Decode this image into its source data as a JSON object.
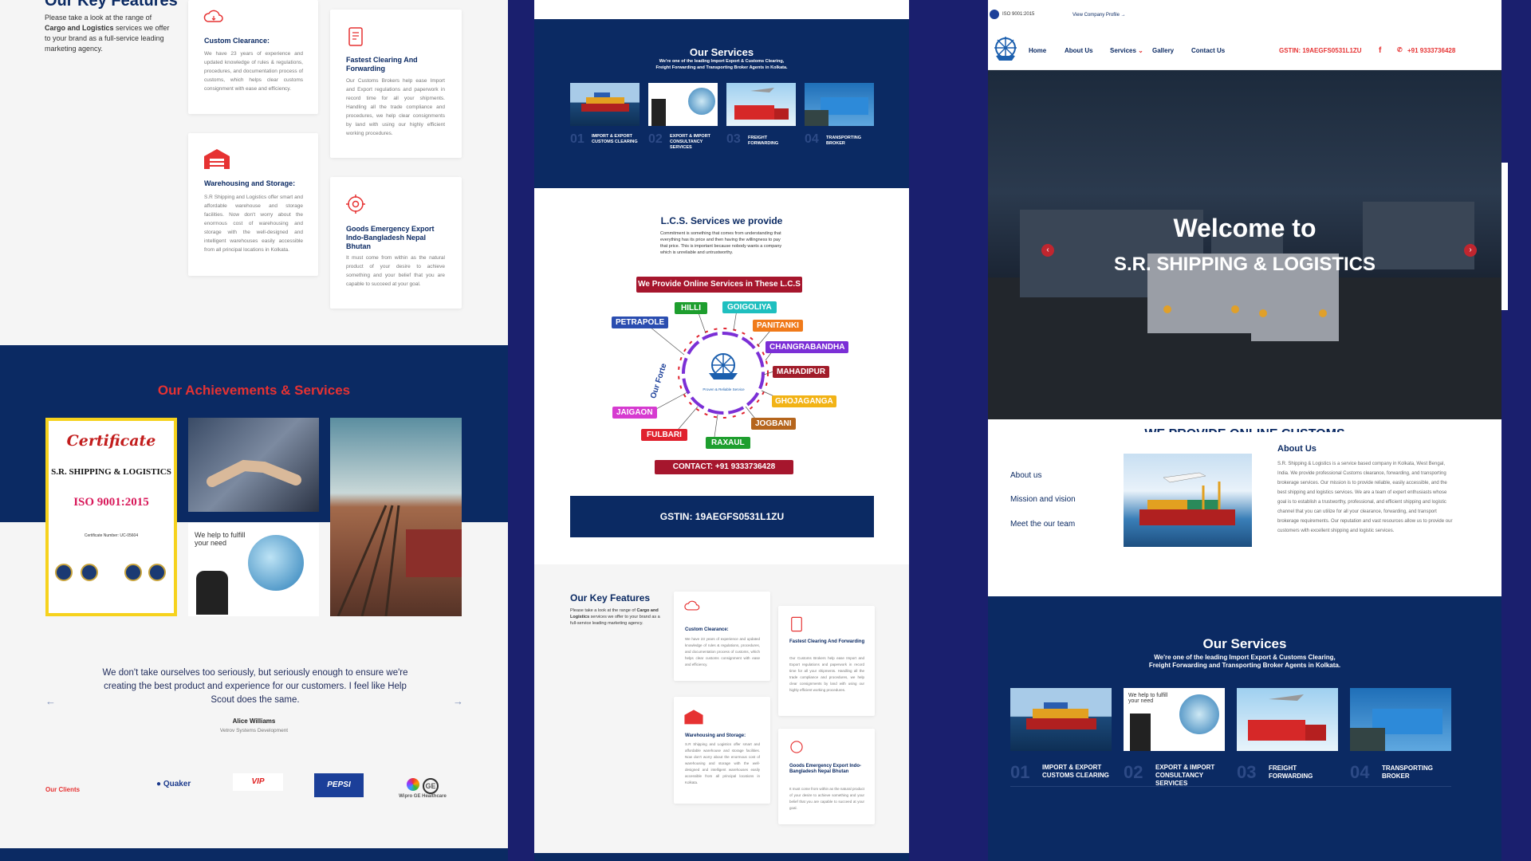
{
  "left": {
    "key_features": {
      "title": "Our Key Features",
      "desc_pre": "Please take a look at the range of ",
      "desc_b1": "Cargo and Logistics",
      "desc_post": " services we offer to your brand as a full-service leading marketing agency.",
      "cards": [
        {
          "icon": "cloud-icon",
          "title": "Custom Clearance:",
          "desc": "We have 23 years of experience and updated knowledge of rules & regulations, procedures, and documentation process of customs, which helps clear customs consignment with ease and efficiency."
        },
        {
          "icon": "document-icon",
          "title": "Fastest Clearing And Forwarding",
          "desc": "Our Customs Brokers help ease Import and Export regulations and paperwork in record time for all your shipments. Handling all the trade compliance and procedures, we help clear consignments by land with using our highly efficient working procedures."
        },
        {
          "icon": "warehouse-icon",
          "title": "Warehousing and Storage:",
          "desc": "S.R Shipping and Logistics offer smart and affordable warehouse and storage facilities. Now don't worry about the enormous cost of warehousing and storage with the well-designed and intelligent warehouses easily accessible from all principal locations in Kolkata."
        },
        {
          "icon": "gear-icon",
          "title": "Goods Emergency Export Indo-Bangladesh Nepal Bhutan",
          "desc": "It must come from within as the natural product of your desire to achieve something and your belief that you are capable to succeed at your goal."
        }
      ]
    },
    "achievements": {
      "title": "Our Achievements & Services",
      "cert": {
        "heading": "Certificate",
        "company": "S.R. SHIPPING & LOGISTICS",
        "iso": "ISO 9001:2015",
        "number": "Certificate Number: UC-05604"
      },
      "photo_text": "We help to fulfill your need"
    },
    "testimonial": {
      "quote": "We don't take ourselves too seriously, but seriously enough to ensure we're creating the best product and experience for our customers. I feel like Help Scout does the same.",
      "name": "Alice Williams",
      "role": "Vetrov Systems Development"
    },
    "clients": {
      "label": "Our Clients",
      "logos": [
        "Quaker",
        "VIP",
        "PEPSI",
        "Wipro GE Healthcare"
      ]
    }
  },
  "middle": {
    "services": {
      "title": "Our Services",
      "subtitle_1": "We're one of the leading Import Export & Customs Clearing,",
      "subtitle_2": "Freight Forwarding and Transporting Broker Agents in Kolkata.",
      "items": [
        {
          "num": "01",
          "label": "IMPORT & EXPORT CUSTOMS CLEARING"
        },
        {
          "num": "02",
          "label": "EXPORT & IMPORT CONSULTANCY SERVICES"
        },
        {
          "num": "03",
          "label": "FREIGHT FORWARDING"
        },
        {
          "num": "04",
          "label": "TRANSPORTING BROKER"
        }
      ]
    },
    "lcs": {
      "title": "L.C.S. Services we provide",
      "desc": "Commitment is something that comes from understanding that everything has its price and then having the willingness to pay that price. This is important because nobody wants a company which is unreliable and untrustworthy.",
      "banner": "We Provide Online Services in These L.C.S",
      "forte": "Our Forte",
      "center_caption": "Proven & Reliable Service",
      "locations": [
        {
          "name": "HILLI",
          "color": "#1e9e2e"
        },
        {
          "name": "GOIGOLIYA",
          "color": "#1fbfbf"
        },
        {
          "name": "PETRAPOLE",
          "color": "#2a4db0"
        },
        {
          "name": "PANITANKI",
          "color": "#f07a1a"
        },
        {
          "name": "CHANGRABANDHA",
          "color": "#7b2fd6"
        },
        {
          "name": "MAHADIPUR",
          "color": "#a11d2a"
        },
        {
          "name": "GHOJAGANGA",
          "color": "#f2b316"
        },
        {
          "name": "JAIGAON",
          "color": "#d63bd0"
        },
        {
          "name": "JOGBANI",
          "color": "#b5651d"
        },
        {
          "name": "FULBARI",
          "color": "#e0222e"
        },
        {
          "name": "RAXAUL",
          "color": "#1e9e2e"
        }
      ],
      "contact": "CONTACT: +91 9333736428"
    },
    "gstin": "GSTIN: 19AEGFS0531L1ZU",
    "key_features": {
      "title": "Our Key Features",
      "desc_pre": "Please take a look at the range of ",
      "desc_b1": "Cargo and Logistics",
      "desc_post": " services we offer to your brand as a full-service leading marketing agency."
    }
  },
  "right": {
    "topbar": {
      "iso": "ISO 9001:2015",
      "profile": "View Company Profile →"
    },
    "nav": {
      "home": "Home",
      "about": "About Us",
      "services": "Services",
      "gallery": "Gallery",
      "contact": "Contact Us",
      "gstin": "GSTIN: 19AEGFS0531L1ZU",
      "phone": "+91 9333736428"
    },
    "hero": {
      "line1": "Welcome to",
      "line2": "S.R. SHIPPING & LOGISTICS"
    },
    "we_provide": "WE PROVIDE ONLINE CUSTOMS",
    "about": {
      "links": [
        "About us",
        "Mission and vision",
        "Meet the our team"
      ],
      "title": "About Us",
      "desc": "S.R. Shipping & Logistics is a service based company in Kolkata, West Bengal, India. We provide professional Customs clearance, forwarding, and transporting brokerage services. Our mission is to provide reliable, easily accessible, and the best shipping and logistics services. We are a team of expert enthusiasts whose goal is to establish a trustworthy, professional, and efficient shipping and logistic channel that you can utilize for all your clearance, forwarding, and transport brokerage requirements. Our reputation and vast resources allow us to provide our customers with excellent shipping and logistic services."
    },
    "services": {
      "title": "Our Services",
      "subtitle_1": "We're one of the leading Import Export & Customs Clearing,",
      "subtitle_2": "Freight Forwarding and Transporting Broker Agents in Kolkata.",
      "items": [
        {
          "num": "01",
          "label": "IMPORT & EXPORT CUSTOMS CLEARING"
        },
        {
          "num": "02",
          "label": "EXPORT & IMPORT CONSULTANCY SERVICES"
        },
        {
          "num": "03",
          "label": "FREIGHT FORWARDING"
        },
        {
          "num": "04",
          "label": "TRANSPORTING BROKER"
        }
      ]
    }
  },
  "colors": {
    "navy": "#0b2a63",
    "red": "#e63232",
    "bg_purple": "#1a1f6e",
    "cert_yellow": "#f6d21d"
  }
}
